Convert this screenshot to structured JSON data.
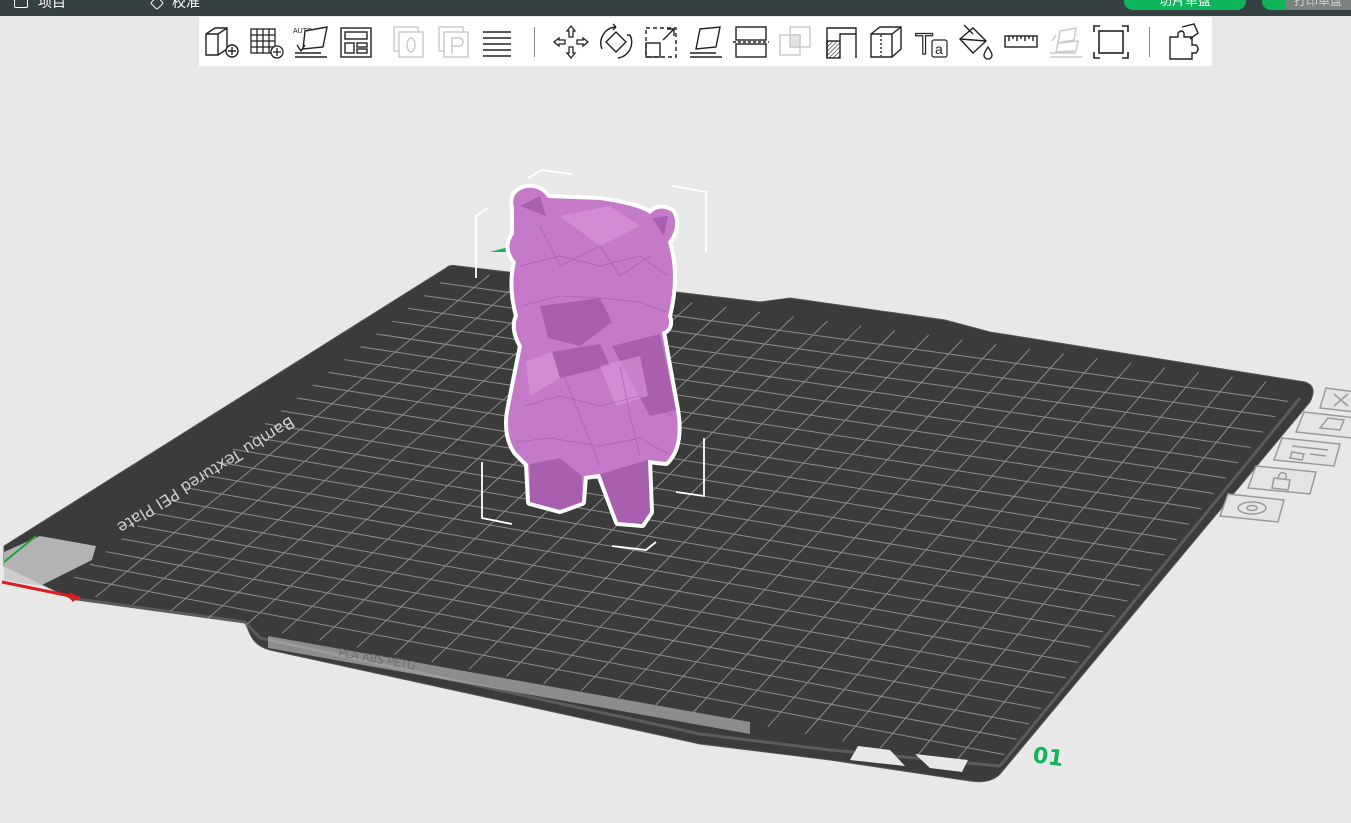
{
  "topbar": {
    "prepare_tab": "项目",
    "preview_tab": "校准",
    "slice_button": "切片单盘",
    "print_button": "打印单盘"
  },
  "toolbar": {
    "tools": [
      {
        "name": "add-object-icon"
      },
      {
        "name": "add-plate-icon"
      },
      {
        "name": "auto-orient-icon",
        "label": "AUTO"
      },
      {
        "name": "arrange-icon"
      },
      {
        "name": "split-objects-icon"
      },
      {
        "name": "split-parts-icon"
      },
      {
        "name": "layers-icon"
      },
      {
        "name": "move-icon"
      },
      {
        "name": "rotate-icon"
      },
      {
        "name": "scale-icon"
      },
      {
        "name": "lay-on-face-icon"
      },
      {
        "name": "cut-icon"
      },
      {
        "name": "boolean-icon"
      },
      {
        "name": "support-paint-icon"
      },
      {
        "name": "seam-paint-icon"
      },
      {
        "name": "text-icon",
        "label": "T",
        "sub": "a"
      },
      {
        "name": "color-paint-icon"
      },
      {
        "name": "measure-icon"
      },
      {
        "name": "assembly-icon"
      },
      {
        "name": "fit-view-icon"
      },
      {
        "name": "variable-layer-icon"
      }
    ]
  },
  "viewport": {
    "plate_label": "Bambu Textured PEI Plate",
    "plate_number": "01",
    "plate_small_text": "PLA  ABS  PETG",
    "colors": {
      "background": "#e8e8e8",
      "plate": "#3a3b3a",
      "grid": "#9a9b9a",
      "model": "#c47ac9",
      "model_dark": "#9d56a3",
      "accent_green": "#10b45a",
      "axis_x": "#d81e1e",
      "axis_y": "#1aa23a"
    }
  },
  "plate_side_buttons": [
    {
      "name": "close-plate-icon"
    },
    {
      "name": "orient-plate-icon"
    },
    {
      "name": "arrange-plate-icon"
    },
    {
      "name": "lock-plate-icon"
    },
    {
      "name": "plate-settings-icon"
    }
  ]
}
